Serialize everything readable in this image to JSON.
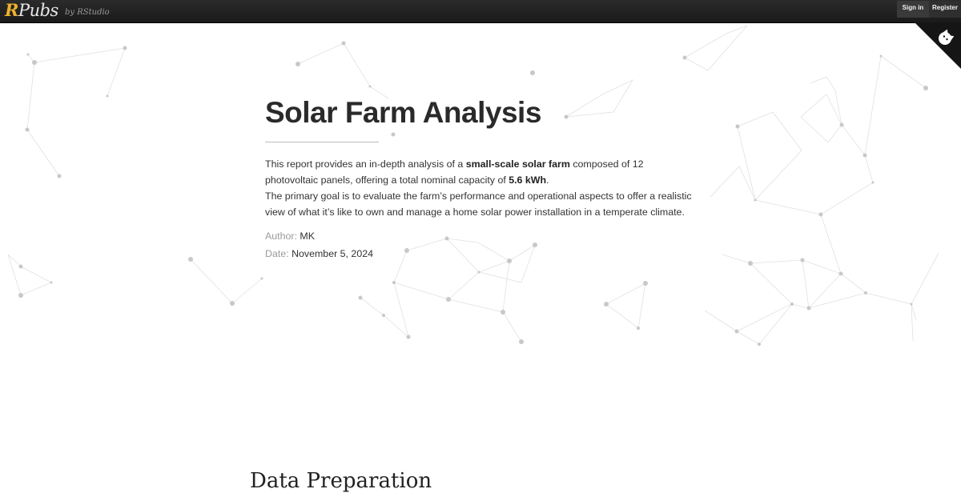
{
  "header": {
    "logo_r": "R",
    "logo_pubs": "Pubs",
    "byline": "by RStudio",
    "signin_label": "Sign in",
    "register_label": "Register"
  },
  "corner": {
    "icon": "github-octocat-icon"
  },
  "report": {
    "title": "Solar Farm Analysis",
    "p1_a": "This report provides an in-depth analysis of a ",
    "p1_b": "small-scale solar farm",
    "p1_c": " composed of 12 photovoltaic panels, offering a total nominal capacity of ",
    "p1_d": "5.6 kWh",
    "p1_e": ".",
    "p2": "The primary goal is to evaluate the farm’s performance and operational aspects to offer a realistic view of what it’s like to own and manage a home solar power installation in a temperate climate.",
    "author_key": "Author: ",
    "author_val": "MK",
    "date_key": "Date: ",
    "date_val": "November 5, 2024"
  },
  "next_section": {
    "heading": "Data Preparation"
  },
  "colors": {
    "topbar": "#1e1e1e",
    "logo_accent": "#f0b12b",
    "network": "#c8c8c8"
  }
}
